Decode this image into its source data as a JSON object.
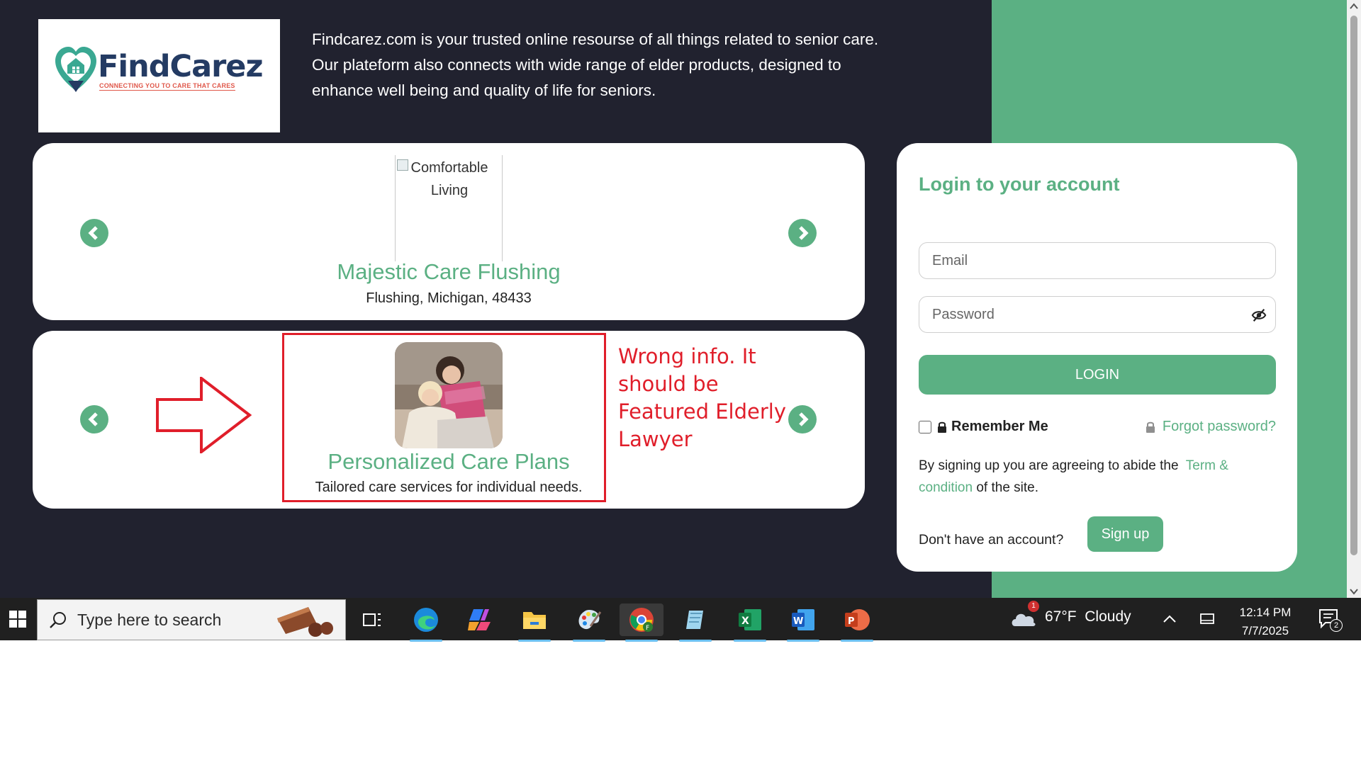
{
  "site": {
    "logo": {
      "name": "FindCarez",
      "tagline": "CONNECTING YOU TO CARE THAT CARES"
    },
    "intro_text": "Findcarez.com is your trusted online resourse of all things related to senior care. Our plateform also connects with wide range of elder products, designed to enhance well being and quality of life for seniors."
  },
  "carousel_1": {
    "image_alt": "Comfortable Living",
    "title": "Majestic Care Flushing",
    "subtitle": "Flushing, Michigan, 48433"
  },
  "carousel_2": {
    "title": "Personalized Care Plans",
    "subtitle": "Tailored care services for individual needs."
  },
  "annotation": {
    "text": "Wrong info. It should be Featured Elderly Lawyer",
    "color": "#e01e2a"
  },
  "login": {
    "title": "Login to your account",
    "email_placeholder": "Email",
    "password_placeholder": "Password",
    "login_button": "LOGIN",
    "remember_me": "Remember Me",
    "forgot_password": "Forgot password?",
    "terms_prefix": "By signing up you are agreeing to abide the",
    "terms_link": "Term & condition",
    "terms_suffix": "of the site.",
    "no_account": "Don't have an account?",
    "signup_button": "Sign up"
  },
  "colors": {
    "brand_green": "#5bb083",
    "background_dark": "#21222f"
  },
  "taskbar": {
    "search_placeholder": "Type here to search",
    "apps": [
      "task-view",
      "edge",
      "copilot",
      "file-explorer",
      "paint",
      "chrome",
      "notepad",
      "excel",
      "word",
      "powerpoint"
    ],
    "weather": {
      "temp": "67°F",
      "condition": "Cloudy",
      "badge": "1"
    },
    "time": "12:14 PM",
    "date": "7/7/2025",
    "notifications": "2"
  }
}
